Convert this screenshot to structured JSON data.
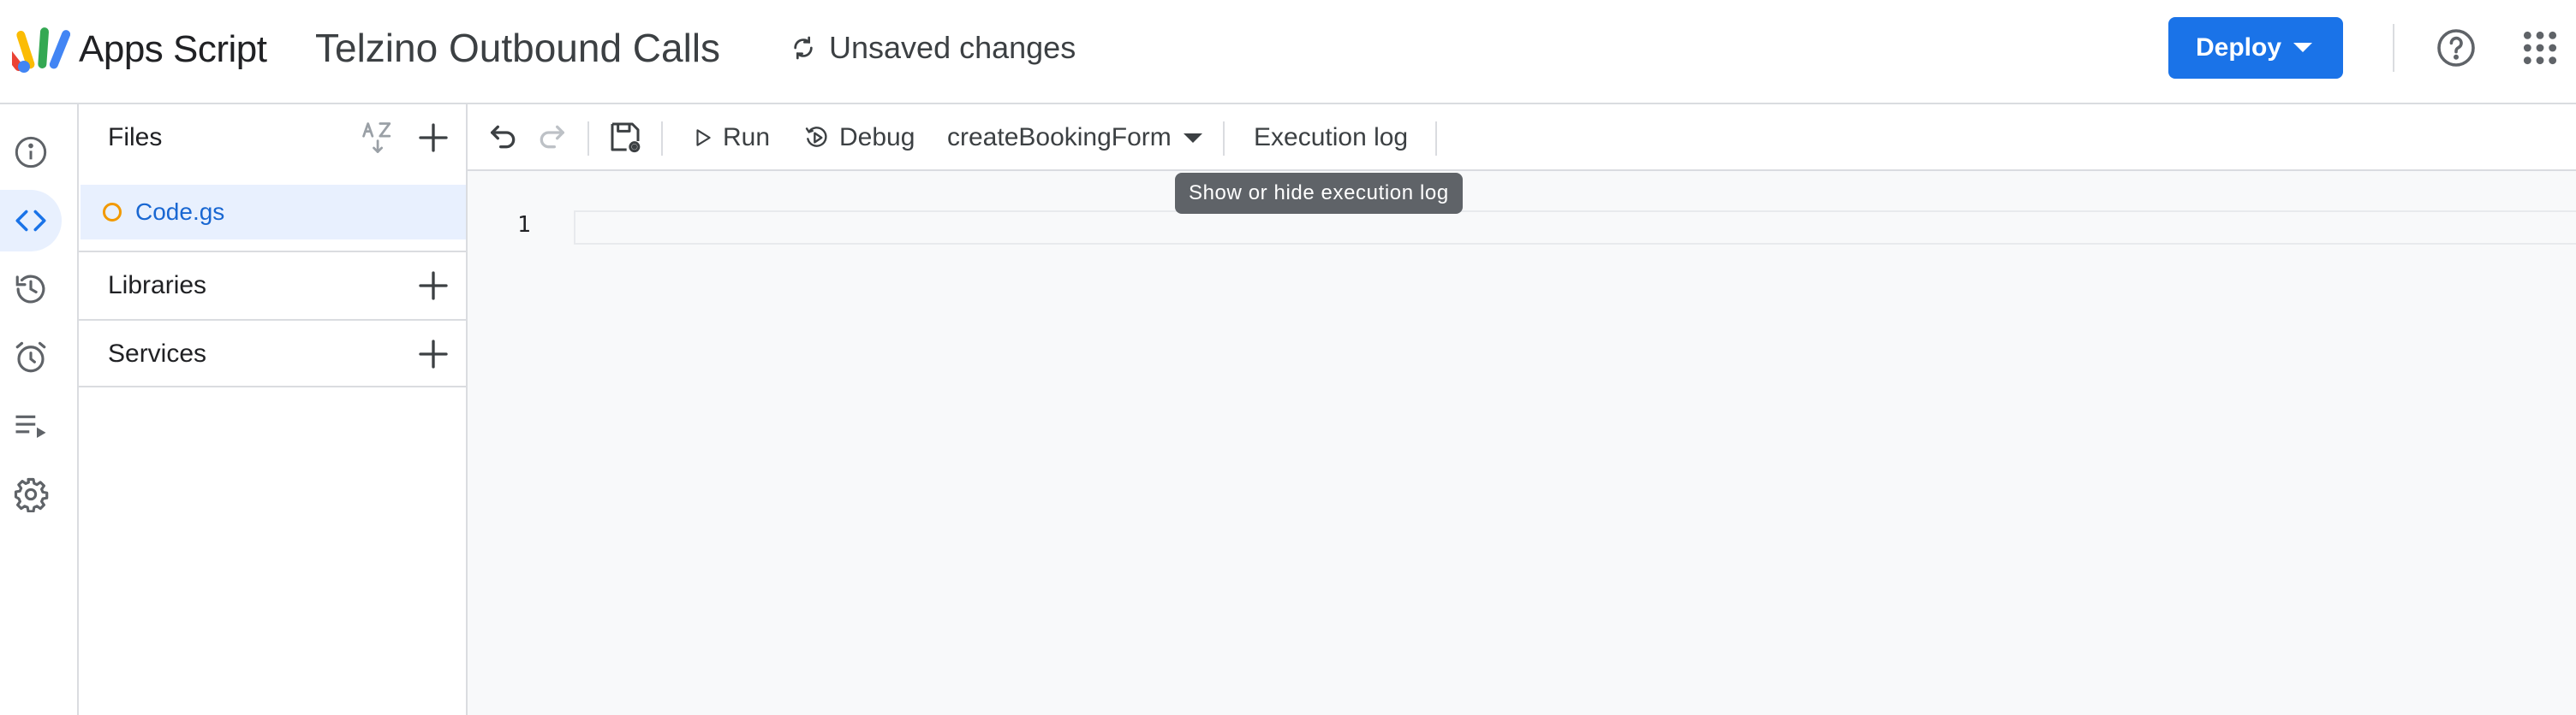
{
  "header": {
    "brand": "Apps Script",
    "project_title": "Telzino Outbound Calls",
    "status": "Unsaved changes",
    "deploy_label": "Deploy"
  },
  "rail": {
    "items": [
      {
        "icon": "info-icon",
        "active": false
      },
      {
        "icon": "code-icon",
        "active": true
      },
      {
        "icon": "history-icon",
        "active": false
      },
      {
        "icon": "alarm-icon",
        "active": false
      },
      {
        "icon": "executions-icon",
        "active": false
      },
      {
        "icon": "gear-icon",
        "active": false
      }
    ]
  },
  "files_panel": {
    "files_label": "Files",
    "files": [
      {
        "name": "Code.gs",
        "selected": true
      }
    ],
    "libraries_label": "Libraries",
    "services_label": "Services"
  },
  "toolbar": {
    "run_label": "Run",
    "debug_label": "Debug",
    "function_selected": "createBookingForm",
    "execution_log_label": "Execution log"
  },
  "tooltip": {
    "text": "Show or hide execution log"
  },
  "editor": {
    "line_numbers": [
      "1"
    ]
  },
  "colors": {
    "accent": "#1a73e8",
    "active_bg": "#e8f0fe",
    "file_link": "#1967d2",
    "unsaved_dot": "#f29900",
    "editor_bg": "#f8f9fa",
    "tooltip_bg": "#5f6368"
  }
}
